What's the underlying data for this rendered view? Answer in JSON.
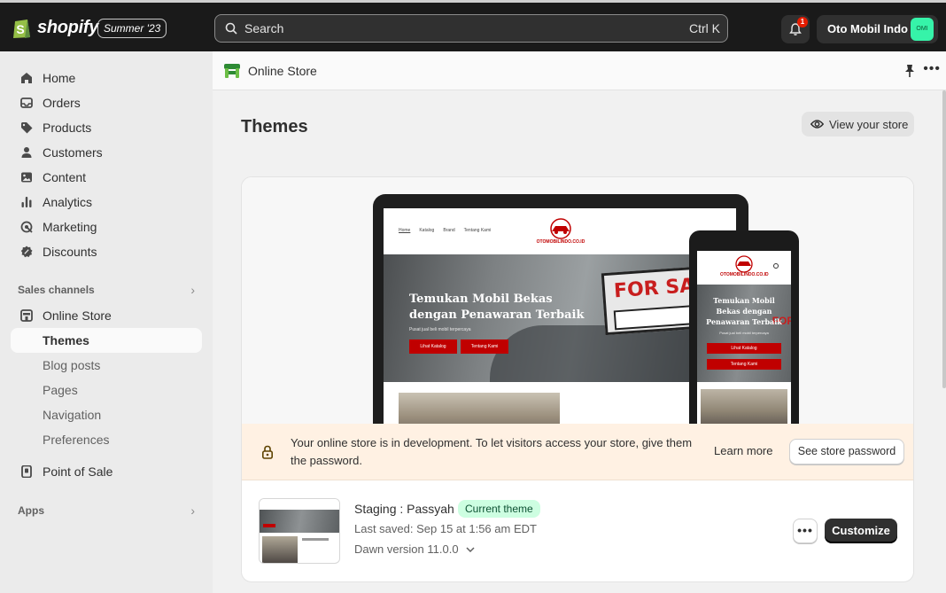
{
  "topbar": {
    "brand": "shopify",
    "edition": "Summer '23",
    "search_placeholder": "Search",
    "search_shortcut": "Ctrl K",
    "notification_count": "1",
    "store_name": "Oto Mobil Indo",
    "avatar_initials": "OMI",
    "avatar_color": "#36f3a9"
  },
  "sidebar": {
    "items": [
      {
        "label": "Home",
        "icon": "home-icon"
      },
      {
        "label": "Orders",
        "icon": "inbox-icon"
      },
      {
        "label": "Products",
        "icon": "tag-icon"
      },
      {
        "label": "Customers",
        "icon": "person-icon"
      },
      {
        "label": "Content",
        "icon": "image-icon"
      },
      {
        "label": "Analytics",
        "icon": "bar-chart-icon"
      },
      {
        "label": "Marketing",
        "icon": "target-icon"
      },
      {
        "label": "Discounts",
        "icon": "discount-icon"
      }
    ],
    "sales_channels_label": "Sales channels",
    "online_store_label": "Online Store",
    "sub_items": [
      "Themes",
      "Blog posts",
      "Pages",
      "Navigation",
      "Preferences"
    ],
    "active_sub_item": "Themes",
    "point_of_sale_label": "Point of Sale",
    "apps_label": "Apps"
  },
  "main": {
    "header_title": "Online Store",
    "page_title": "Themes",
    "view_store_label": "View your store",
    "preview": {
      "nav_links": [
        "Home",
        "Katalog",
        "Brand",
        "Tentang Kami"
      ],
      "site_brand": "OTOMOBILINDO.CO.ID",
      "hero_heading": "Temukan Mobil Bekas dengan Penawaran Terbaik",
      "hero_sub": "Pusat jual beli mobil terpercaya",
      "btn_catalog": "Lihat Katalog",
      "btn_about": "Tentang Kami",
      "sign_text": "FOR SAL",
      "phone_sign_text": "FOR",
      "accent_color": "#c00000"
    },
    "banner": {
      "message": "Your online store is in development. To let visitors access your store, give them the password.",
      "learn_more": "Learn more",
      "password_button": "See store password"
    },
    "theme": {
      "name": "Staging : Passyah",
      "status_badge": "Current theme",
      "last_saved": "Last saved: Sep 15 at 1:56 am EDT",
      "version": "Dawn version 11.0.0",
      "more_label": "•••",
      "customize_label": "Customize"
    }
  }
}
